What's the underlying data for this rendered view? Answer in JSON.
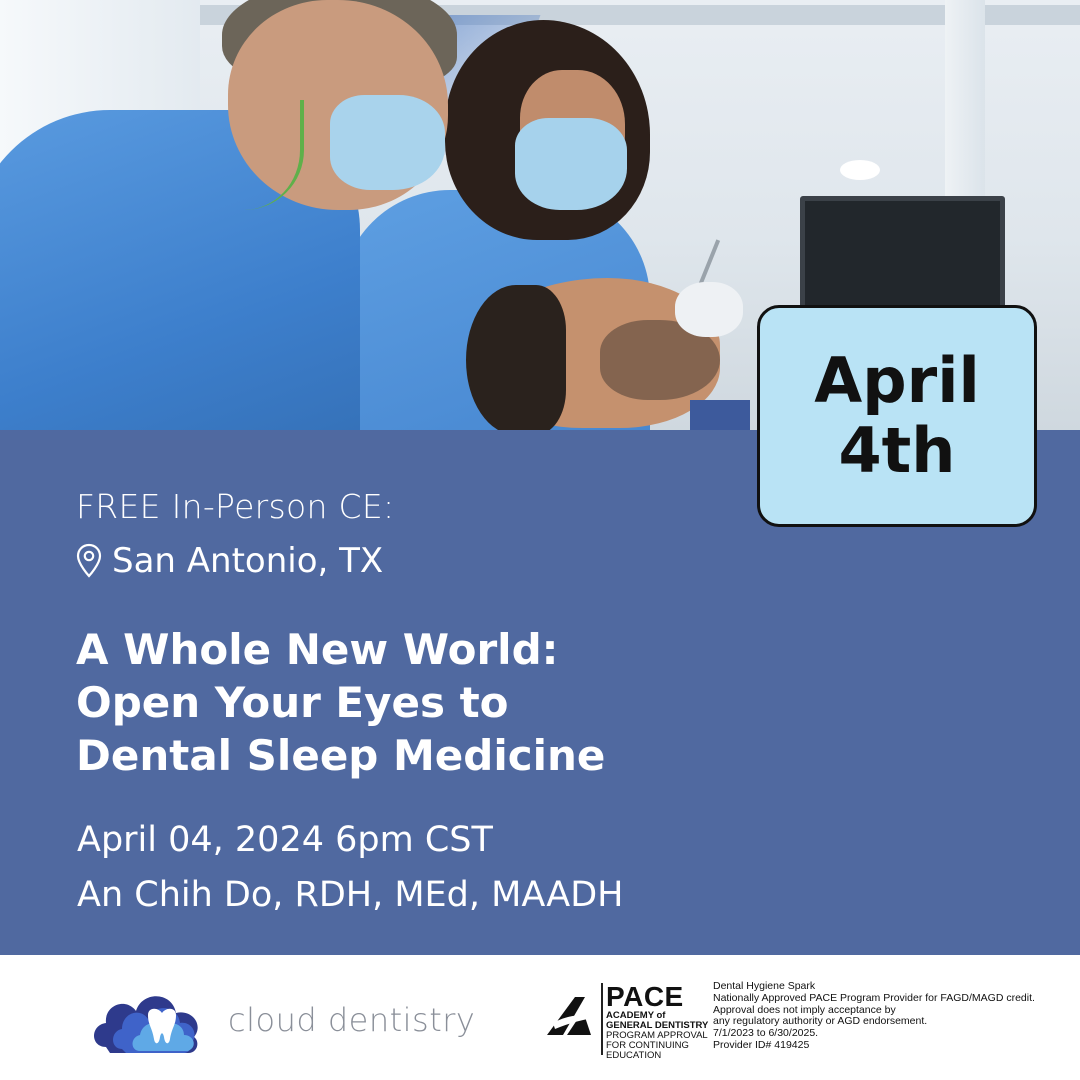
{
  "badge": {
    "line1": "April",
    "line2": "4th"
  },
  "event": {
    "eyebrow": "FREE In-Person CE:",
    "location": "San Antonio, TX",
    "title_lines": [
      "A Whole New World:",
      "Open Your Eyes to",
      "Dental Sleep Medicine"
    ],
    "date": "April 04, 2024 6pm CST",
    "speaker": "An Chih Do, RDH, MEd, MAADH"
  },
  "brand": {
    "name": "cloud dentistry",
    "colors": [
      "#2e3a8c",
      "#3f63c9",
      "#5fa9e6"
    ]
  },
  "pace": {
    "title": "PACE",
    "line1": "ACADEMY of",
    "line2": "GENERAL DENTISTRY",
    "line3": "PROGRAM APPROVAL",
    "line4": "FOR CONTINUING",
    "line5": "EDUCATION",
    "info": [
      "Dental Hygiene Spark",
      "Nationally Approved PACE Program Provider for FAGD/MAGD credit.",
      "Approval does not imply acceptance by",
      "any regulatory authority or AGD endorsement.",
      "7/1/2023 to 6/30/2025.",
      "Provider ID# 419425"
    ]
  },
  "colors": {
    "panel": "#5069a0",
    "badge": "#b9e3f5",
    "text": "#ffffff"
  },
  "icons": {
    "location": "map-pin-icon"
  }
}
